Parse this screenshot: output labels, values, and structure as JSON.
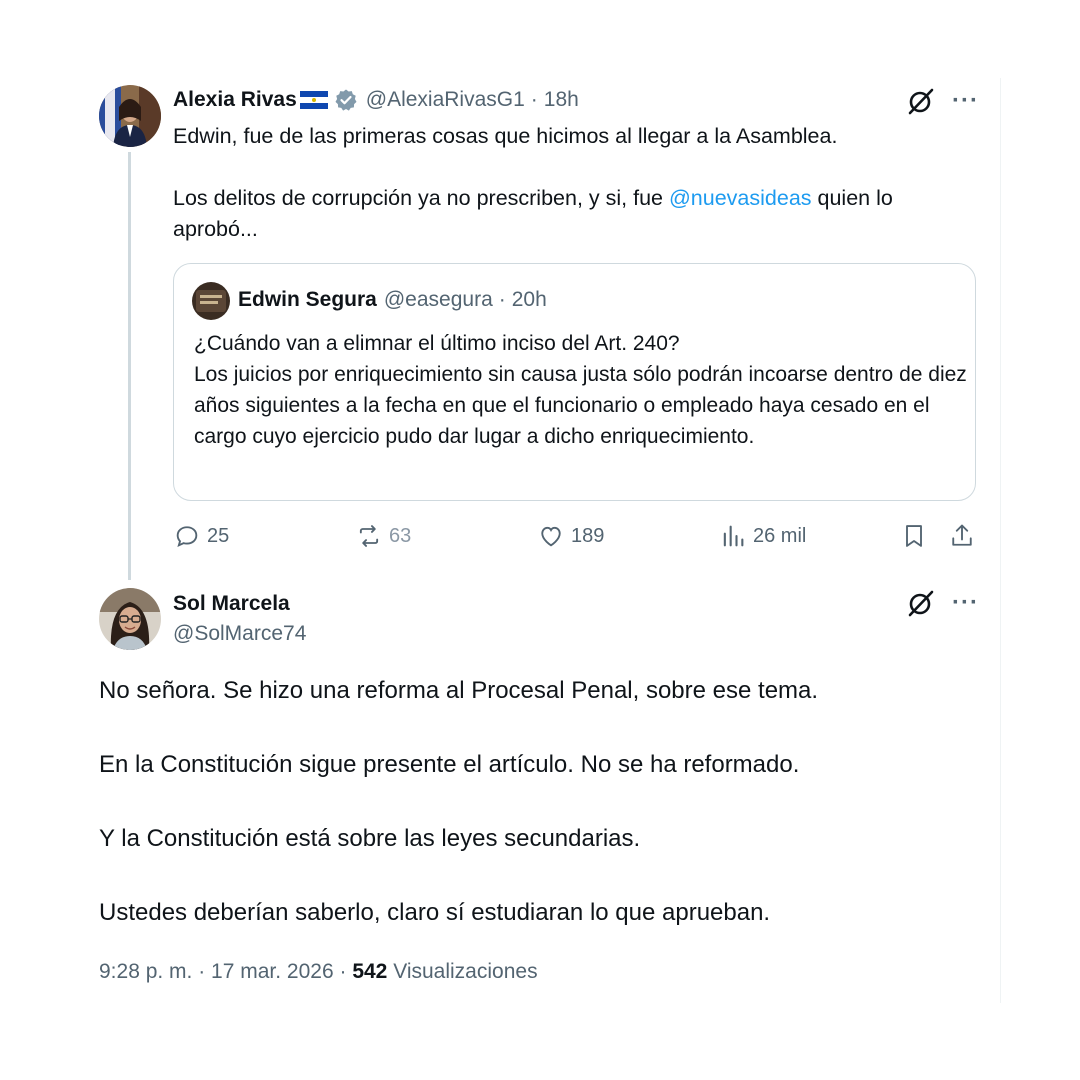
{
  "tweet": {
    "author_name": "Alexia Rivas",
    "handle": "@AlexiaRivasG1",
    "time": "18h",
    "line1": "Edwin, fue de las primeras cosas que hicimos al llegar a la Asamblea.",
    "line2_before": "Los delitos de corrupción ya no prescriben, y si, fue ",
    "line2_mention": "@nuevasideas",
    "line2_after": " quien lo aprobó...",
    "quote": {
      "author_name": "Edwin Segura",
      "handle": "@easegura",
      "time": "20h",
      "text_line1": "¿Cuándo van a elimnar el último inciso del Art. 240?",
      "text_line2": "Los juicios por enriquecimiento sin causa justa sólo podrán incoarse dentro de diez años siguientes a la fecha en que el funcionario o empleado haya cesado en el cargo cuyo ejercicio pudo dar lugar a dicho enriquecimiento."
    },
    "actions": {
      "replies": "25",
      "reposts": "63",
      "likes": "189",
      "views": "26 mil"
    }
  },
  "reply": {
    "author_name": "Sol Marcela",
    "handle": "@SolMarce74",
    "paragraphs": [
      "No señora. Se hizo una reforma al Procesal Penal, sobre ese tema.",
      "En la Constitución sigue presente el artículo. No se ha reformado.",
      "Y la Constitución está sobre las leyes secundarias.",
      "Ustedes deberían saberlo, claro sí estudiaran lo que aprueban."
    ],
    "timestamp": "9:28 p. m. · 17 mar. 2026",
    "separator": " · ",
    "views_count": "542",
    "views_label": "Visualizaciones"
  },
  "separator_dot": "·",
  "more_glyph": "···",
  "icons": {
    "grok": "grok-icon",
    "more": "more-icon",
    "reply": "reply-icon",
    "repost": "repost-icon",
    "like": "heart-icon",
    "views": "views-icon",
    "bookmark": "bookmark-icon",
    "share": "share-icon",
    "verified": "verified-badge-icon",
    "flag": "el-salvador-flag-icon"
  },
  "colors": {
    "link": "#1d9bf0",
    "muted": "#536471",
    "text": "#0f1419",
    "border": "#cfd9de"
  }
}
